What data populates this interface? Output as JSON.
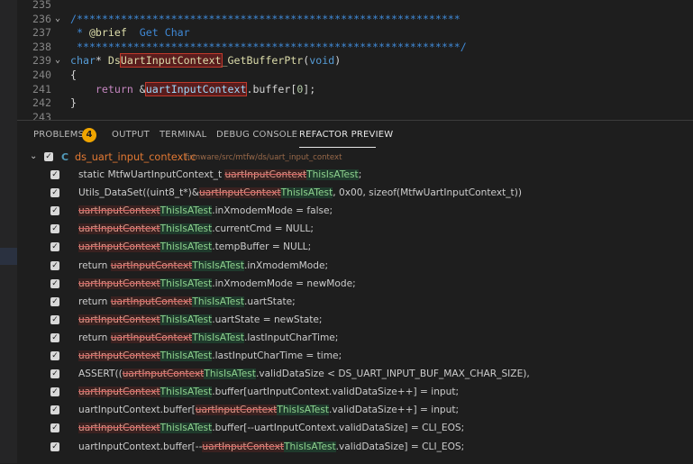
{
  "editor": {
    "lines": [
      {
        "num": "235",
        "fold": "",
        "segments": []
      },
      {
        "num": "236",
        "fold": "⌄",
        "segments": [
          {
            "t": "/*************************************************************",
            "c": "c-comment"
          }
        ]
      },
      {
        "num": "237",
        "fold": "",
        "segments": [
          {
            "t": " * ",
            "c": "c-comment"
          },
          {
            "t": "@brief",
            "c": "c-fn"
          },
          {
            "t": "  Get Char",
            "c": "c-comment"
          }
        ]
      },
      {
        "num": "238",
        "fold": "",
        "segments": [
          {
            "t": " *************************************************************/",
            "c": "c-comment"
          }
        ]
      },
      {
        "num": "239",
        "fold": "⌄",
        "segments": [
          {
            "t": "char",
            "c": "c-kw"
          },
          {
            "t": "* ",
            "c": "c-str"
          },
          {
            "t": "Ds",
            "c": "c-fn"
          },
          {
            "t": "UartInputContext",
            "c": "c-fn sel-box"
          },
          {
            "t": "_GetBufferPtr",
            "c": "c-fn"
          },
          {
            "t": "(",
            "c": "c-str"
          },
          {
            "t": "void",
            "c": "c-kw"
          },
          {
            "t": ")",
            "c": "c-str"
          }
        ]
      },
      {
        "num": "240",
        "fold": "",
        "segments": [
          {
            "t": "{",
            "c": "c-str"
          }
        ]
      },
      {
        "num": "241",
        "fold": "",
        "segments": [
          {
            "t": "    ",
            "c": "c-str"
          },
          {
            "t": "return",
            "c": "c-tag"
          },
          {
            "t": " &",
            "c": "c-str"
          },
          {
            "t": "uartInputContext",
            "c": "c-var sel-box"
          },
          {
            "t": ".buffer[",
            "c": "c-str"
          },
          {
            "t": "0",
            "c": "c-num"
          },
          {
            "t": "];",
            "c": "c-str"
          }
        ]
      },
      {
        "num": "242",
        "fold": "",
        "segments": [
          {
            "t": "}",
            "c": "c-str"
          }
        ]
      },
      {
        "num": "243",
        "fold": "",
        "segments": []
      }
    ]
  },
  "panel": {
    "tabs": [
      {
        "label": "PROBLEMS",
        "active": false
      },
      {
        "label": "OUTPUT",
        "active": false
      },
      {
        "label": "TERMINAL",
        "active": false
      },
      {
        "label": "DEBUG CONSOLE",
        "active": false
      },
      {
        "label": "REFACTOR PREVIEW",
        "active": true
      }
    ],
    "problems_count": "4",
    "file": {
      "icon": "C",
      "name": "ds_uart_input_context.c",
      "path": "firmware/src/mtfw/ds/uart_input_context"
    },
    "rows": [
      [
        {
          "t": "static MtfwUartInputContext_t "
        },
        {
          "t": "uartInputContext",
          "k": "del"
        },
        {
          "t": "ThisIsATest",
          "k": "ins"
        },
        {
          "t": ";"
        }
      ],
      [
        {
          "t": "Utils_DataSet((uint8_t*)&"
        },
        {
          "t": "uartInputContext",
          "k": "del"
        },
        {
          "t": "ThisIsATest",
          "k": "ins"
        },
        {
          "t": ", 0x00, sizeof(MtfwUartInputContext_t))"
        }
      ],
      [
        {
          "t": "uartInputContext",
          "k": "del"
        },
        {
          "t": "ThisIsATest",
          "k": "ins"
        },
        {
          "t": ".inXmodemMode = false;"
        }
      ],
      [
        {
          "t": "uartInputContext",
          "k": "del"
        },
        {
          "t": "ThisIsATest",
          "k": "ins"
        },
        {
          "t": ".currentCmd = NULL;"
        }
      ],
      [
        {
          "t": "uartInputContext",
          "k": "del"
        },
        {
          "t": "ThisIsATest",
          "k": "ins"
        },
        {
          "t": ".tempBuffer = NULL;"
        }
      ],
      [
        {
          "t": "return "
        },
        {
          "t": "uartInputContext",
          "k": "del"
        },
        {
          "t": "ThisIsATest",
          "k": "ins"
        },
        {
          "t": ".inXmodemMode;"
        }
      ],
      [
        {
          "t": "uartInputContext",
          "k": "del"
        },
        {
          "t": "ThisIsATest",
          "k": "ins"
        },
        {
          "t": ".inXmodemMode = newMode;"
        }
      ],
      [
        {
          "t": "return "
        },
        {
          "t": "uartInputContext",
          "k": "del"
        },
        {
          "t": "ThisIsATest",
          "k": "ins"
        },
        {
          "t": ".uartState;"
        }
      ],
      [
        {
          "t": "uartInputContext",
          "k": "del"
        },
        {
          "t": "ThisIsATest",
          "k": "ins"
        },
        {
          "t": ".uartState = newState;"
        }
      ],
      [
        {
          "t": "return "
        },
        {
          "t": "uartInputContext",
          "k": "del"
        },
        {
          "t": "ThisIsATest",
          "k": "ins"
        },
        {
          "t": ".lastInputCharTime;"
        }
      ],
      [
        {
          "t": "uartInputContext",
          "k": "del"
        },
        {
          "t": "ThisIsATest",
          "k": "ins"
        },
        {
          "t": ".lastInputCharTime = time;"
        }
      ],
      [
        {
          "t": "ASSERT(("
        },
        {
          "t": "uartInputContext",
          "k": "del"
        },
        {
          "t": "ThisIsATest",
          "k": "ins"
        },
        {
          "t": ".validDataSize < DS_UART_INPUT_BUF_MAX_CHAR_SIZE),"
        }
      ],
      [
        {
          "t": "uartInputContext",
          "k": "del"
        },
        {
          "t": "ThisIsATest",
          "k": "ins"
        },
        {
          "t": ".buffer[uartInputContext.validDataSize++] = input;"
        }
      ],
      [
        {
          "t": "uartInputContext.buffer["
        },
        {
          "t": "uartInputContext",
          "k": "del"
        },
        {
          "t": "ThisIsATest",
          "k": "ins"
        },
        {
          "t": ".validDataSize++] = input;"
        }
      ],
      [
        {
          "t": "uartInputContext",
          "k": "del"
        },
        {
          "t": "ThisIsATest",
          "k": "ins"
        },
        {
          "t": ".buffer[--uartInputContext.validDataSize] = CLI_EOS;"
        }
      ],
      [
        {
          "t": "uartInputContext.buffer[--"
        },
        {
          "t": "uartInputContext",
          "k": "del"
        },
        {
          "t": "ThisIsATest",
          "k": "ins"
        },
        {
          "t": ".validDataSize] = CLI_EOS;"
        }
      ]
    ]
  }
}
